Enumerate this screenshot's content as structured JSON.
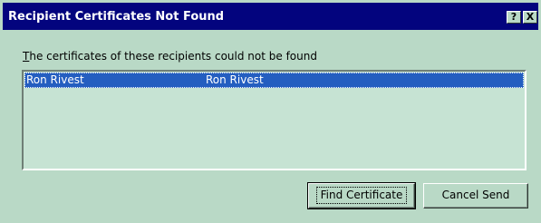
{
  "window": {
    "title": "Recipient Certificates Not Found",
    "help_glyph": "?",
    "close_glyph": "X"
  },
  "message": {
    "first_letter": "T",
    "rest": "he certificates of these recipients could not be found"
  },
  "recipients": [
    {
      "name": "Ron Rivest",
      "email": "Ron Rivest"
    }
  ],
  "buttons": {
    "find_certificate": "Find Certificate",
    "cancel_send": "Cancel Send"
  },
  "colors": {
    "titlebar": "#03047e",
    "selection": "#245ec0",
    "face": "#b9d9c6"
  }
}
